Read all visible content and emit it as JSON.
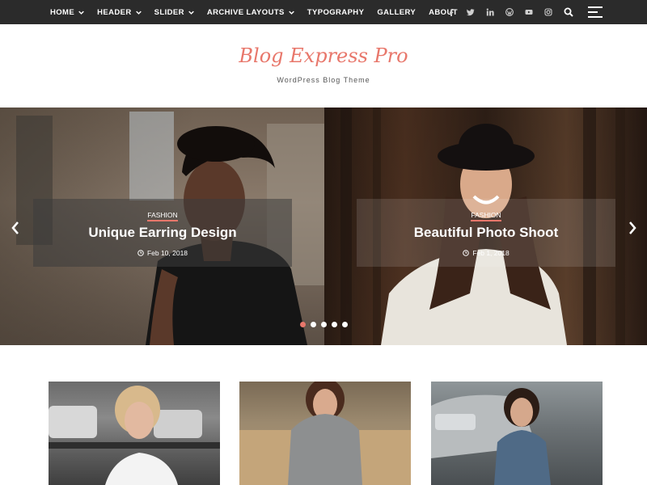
{
  "nav": {
    "items": [
      {
        "label": "HOME",
        "has_dropdown": true
      },
      {
        "label": "HEADER",
        "has_dropdown": true
      },
      {
        "label": "SLIDER",
        "has_dropdown": true
      },
      {
        "label": "ARCHIVE LAYOUTS",
        "has_dropdown": true
      },
      {
        "label": "TYPOGRAPHY",
        "has_dropdown": false
      },
      {
        "label": "GALLERY",
        "has_dropdown": false
      },
      {
        "label": "ABOUT",
        "has_dropdown": false
      }
    ],
    "socials": [
      "facebook-icon",
      "twitter-icon",
      "linkedin-icon",
      "wordpress-icon",
      "youtube-icon",
      "instagram-icon"
    ],
    "search_icon": "search-icon",
    "menu_icon": "hamburger-menu-icon"
  },
  "branding": {
    "title": "Blog Express Pro",
    "tagline": "WordPress Blog Theme"
  },
  "slider": {
    "slides": [
      {
        "category": "FASHION",
        "title": "Unique Earring Design",
        "date": "Feb 10, 2018"
      },
      {
        "category": "FASHION",
        "title": "Beautiful Photo Shoot",
        "date": "Feb 1, 2018"
      }
    ],
    "dots_count": 5,
    "active_dot": 0
  },
  "colors": {
    "accent": "#e8776b",
    "topbar": "#2b2b2b"
  }
}
